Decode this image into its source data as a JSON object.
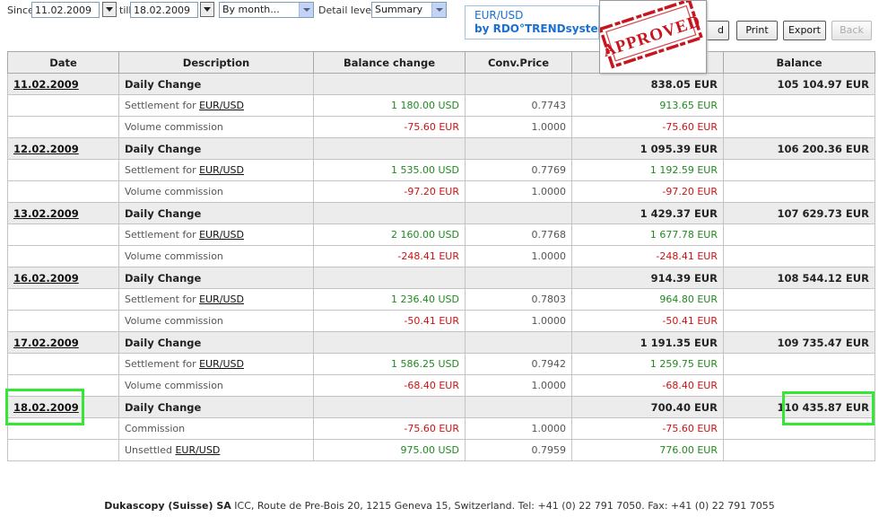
{
  "toolbar": {
    "since_label": "Since",
    "since_value": "11.02.2009",
    "till_label": "till",
    "till_value": "18.02.2009",
    "period_value": "By month...",
    "detail_label": "Detail level:",
    "detail_value": "Summary",
    "buttons": {
      "partial_label": "d",
      "print_label": "Print",
      "export_label": "Export",
      "back_label": "Back"
    }
  },
  "logo": {
    "line1": "EUR/USD",
    "line2": "by RDO°TRENDsystem"
  },
  "stamp": {
    "text": "APPROVED",
    "color": "#c8141e"
  },
  "table": {
    "headers": [
      "Date",
      "Description",
      "Balance change",
      "Conv.Price",
      "",
      "Balance"
    ],
    "groups": [
      {
        "date": "11.02.2009",
        "summary": {
          "description": "Daily Change",
          "amount": "838.05 EUR",
          "balance": "105 104.97 EUR"
        },
        "rows": [
          {
            "prefix": "Settlement for ",
            "pair": "EUR/USD",
            "change": "1 180.00 USD",
            "price": "0.7743",
            "amount": "913.65 EUR",
            "sign": "pos"
          },
          {
            "prefix": "Volume commission",
            "pair": "",
            "change": "-75.60 EUR",
            "price": "1.0000",
            "amount": "-75.60 EUR",
            "sign": "neg"
          }
        ]
      },
      {
        "date": "12.02.2009",
        "summary": {
          "description": "Daily Change",
          "amount": "1 095.39 EUR",
          "balance": "106 200.36 EUR"
        },
        "rows": [
          {
            "prefix": "Settlement for ",
            "pair": "EUR/USD",
            "change": "1 535.00 USD",
            "price": "0.7769",
            "amount": "1 192.59 EUR",
            "sign": "pos"
          },
          {
            "prefix": "Volume commission",
            "pair": "",
            "change": "-97.20 EUR",
            "price": "1.0000",
            "amount": "-97.20 EUR",
            "sign": "neg"
          }
        ]
      },
      {
        "date": "13.02.2009",
        "summary": {
          "description": "Daily Change",
          "amount": "1 429.37 EUR",
          "balance": "107 629.73 EUR"
        },
        "rows": [
          {
            "prefix": "Settlement for ",
            "pair": "EUR/USD",
            "change": "2 160.00 USD",
            "price": "0.7768",
            "amount": "1 677.78 EUR",
            "sign": "pos"
          },
          {
            "prefix": "Volume commission",
            "pair": "",
            "change": "-248.41 EUR",
            "price": "1.0000",
            "amount": "-248.41 EUR",
            "sign": "neg"
          }
        ]
      },
      {
        "date": "16.02.2009",
        "summary": {
          "description": "Daily Change",
          "amount": "914.39 EUR",
          "balance": "108 544.12 EUR"
        },
        "rows": [
          {
            "prefix": "Settlement for ",
            "pair": "EUR/USD",
            "change": "1 236.40 USD",
            "price": "0.7803",
            "amount": "964.80 EUR",
            "sign": "pos"
          },
          {
            "prefix": "Volume commission",
            "pair": "",
            "change": "-50.41 EUR",
            "price": "1.0000",
            "amount": "-50.41 EUR",
            "sign": "neg"
          }
        ]
      },
      {
        "date": "17.02.2009",
        "summary": {
          "description": "Daily Change",
          "amount": "1 191.35 EUR",
          "balance": "109 735.47 EUR"
        },
        "rows": [
          {
            "prefix": "Settlement for ",
            "pair": "EUR/USD",
            "change": "1 586.25 USD",
            "price": "0.7942",
            "amount": "1 259.75 EUR",
            "sign": "pos"
          },
          {
            "prefix": "Volume commission",
            "pair": "",
            "change": "-68.40 EUR",
            "price": "1.0000",
            "amount": "-68.40 EUR",
            "sign": "neg"
          }
        ]
      },
      {
        "date": "18.02.2009",
        "summary": {
          "description": "Daily Change",
          "amount": "700.40 EUR",
          "balance": "110 435.87 EUR"
        },
        "rows": [
          {
            "prefix": "Commission",
            "pair": "",
            "change": "-75.60 EUR",
            "price": "1.0000",
            "amount": "-75.60 EUR",
            "sign": "neg"
          },
          {
            "prefix": "Unsettled ",
            "pair": "EUR/USD",
            "change": "975.00 USD",
            "price": "0.7959",
            "amount": "776.00 EUR",
            "sign": "pos"
          }
        ]
      }
    ]
  },
  "highlight_color": "#35e635",
  "footer": {
    "company": "Dukascopy (Suisse) SA",
    "address": " ICC, Route de Pre-Bois 20, 1215 Geneva 15, Switzerland. Tel: +41 (0) 22 791 7050. Fax: +41 (0) 22 791 7055"
  }
}
